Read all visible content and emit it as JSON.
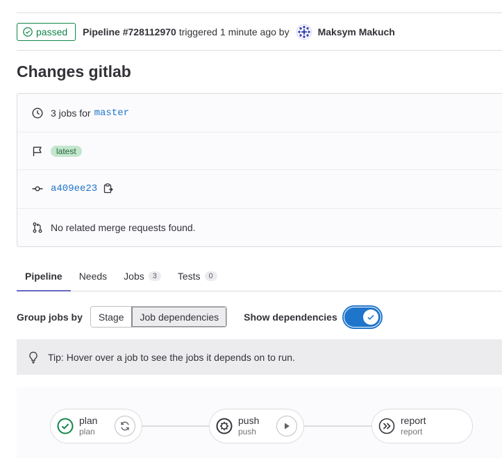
{
  "header": {
    "status": "passed",
    "pipeline_id": "Pipeline #728112970",
    "triggered_text": "triggered 1 minute ago by",
    "user_name": "Maksym Makuch"
  },
  "title": "Changes gitlab",
  "info": {
    "jobs_prefix": "3 jobs for",
    "branch": "master",
    "badge": "latest",
    "commit": "a409ee23",
    "merge_requests": "No related merge requests found."
  },
  "tabs": [
    {
      "label": "Pipeline"
    },
    {
      "label": "Needs"
    },
    {
      "label": "Jobs",
      "count": "3"
    },
    {
      "label": "Tests",
      "count": "0"
    }
  ],
  "controls": {
    "group_label": "Group jobs by",
    "stage_option": "Stage",
    "deps_option": "Job dependencies",
    "show_deps_label": "Show dependencies",
    "show_deps_on": true
  },
  "tip": "Tip: Hover over a job to see the jobs it depends on to run.",
  "jobs": [
    {
      "name": "plan",
      "stage": "plan",
      "status_icon": "success-icon",
      "action_icon": "retry-icon"
    },
    {
      "name": "push",
      "stage": "push",
      "status_icon": "manual-icon",
      "action_icon": "play-icon"
    },
    {
      "name": "report",
      "stage": "report",
      "status_icon": "skipped-icon",
      "action_icon": null
    }
  ],
  "colors": {
    "success": "#108548",
    "link": "#1f75cb",
    "tab_active": "#6666c4"
  }
}
